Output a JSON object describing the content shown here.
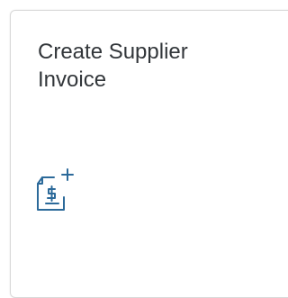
{
  "tile": {
    "title": "Create Supplier Invoice",
    "icon": "create-supplier-invoice-icon",
    "icon_color": "#2c6a9a",
    "text_color": "#32363a",
    "border_color": "#d9d9d9"
  }
}
